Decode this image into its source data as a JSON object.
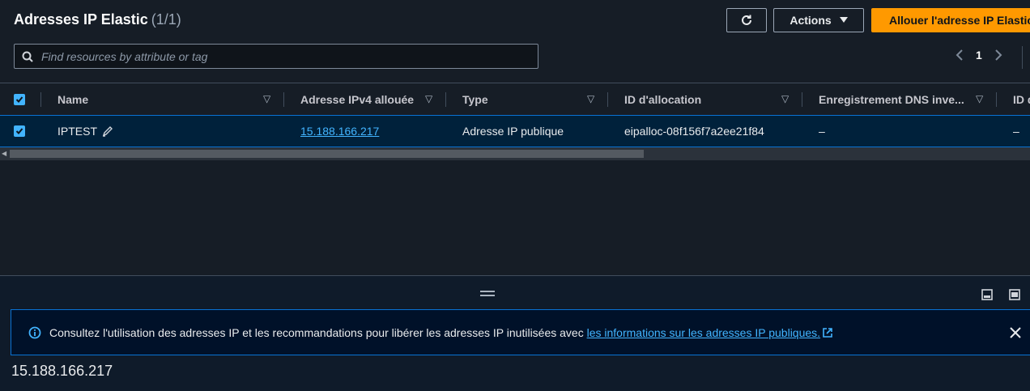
{
  "header": {
    "title": "Adresses IP Elastic",
    "count": "(1/1)",
    "refresh_icon": "refresh-icon",
    "actions_label": "Actions",
    "primary_label": "Allouer l'adresse IP Elastic"
  },
  "search": {
    "placeholder": "Find resources by attribute or tag",
    "value": ""
  },
  "pagination": {
    "current_page": "1"
  },
  "table": {
    "columns": [
      "Name",
      "Adresse IPv4 allouée",
      "Type",
      "ID d'allocation",
      "Enregistrement DNS inve...",
      "ID d"
    ],
    "rows": [
      {
        "name": "IPTEST",
        "ipv4": "15.188.166.217",
        "type": "Adresse IP publique",
        "allocation_id": "eipalloc-08f156f7a2ee21f84",
        "dns": "–",
        "idd": "–"
      }
    ]
  },
  "info": {
    "text": "Consultez l'utilisation des adresses IP et les recommandations pour libérer les adresses IP inutilisées avec",
    "link": "les informations sur les adresses IP publiques."
  },
  "details": {
    "selected_ip": "15.188.166.217"
  },
  "colors": {
    "accent": "#ff9900",
    "link": "#42b4ff",
    "selection": "#0972d3"
  }
}
